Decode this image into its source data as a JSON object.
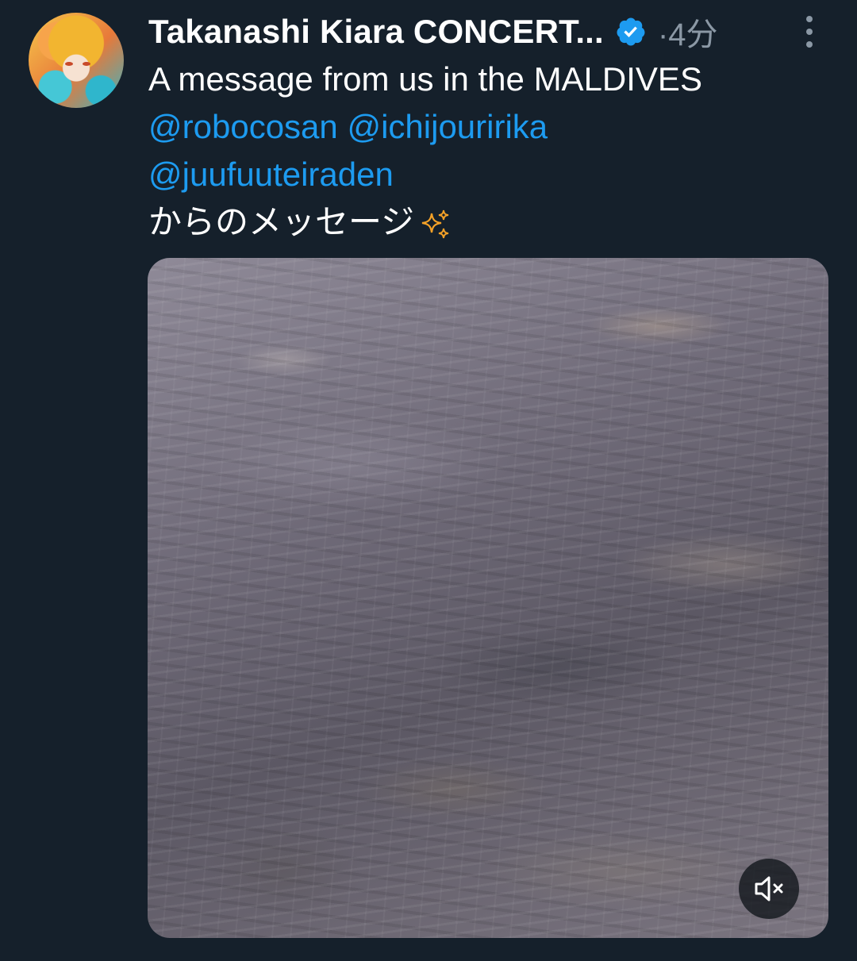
{
  "tweet": {
    "display_name": "Takanashi Kiara CONCERT...",
    "separator": "·",
    "time": "4分",
    "text_line1": "A message from us in the MALDIVES",
    "mentions": [
      "@robocosan",
      "@ichijouririka",
      "@juufuuteiraden"
    ],
    "text_line4": "からのメッセージ",
    "emoji": "sparkles-icon"
  },
  "colors": {
    "background": "#15202b",
    "mention": "#1d9bf0",
    "verified": "#1d9bf0",
    "secondary_text": "#8b98a5",
    "sparkle": "#f4a127"
  },
  "media": {
    "type": "video",
    "muted": true
  }
}
